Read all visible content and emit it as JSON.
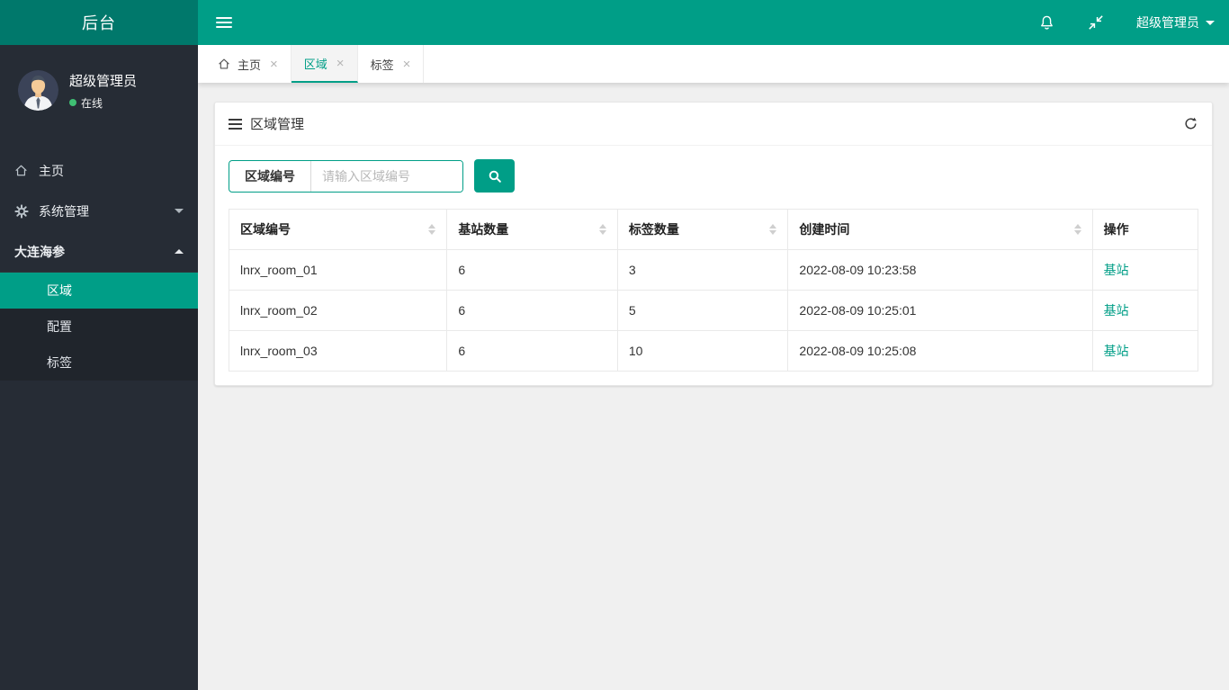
{
  "colors": {
    "accent_teal": "#009e87",
    "logo_teal_dark": "#00786b",
    "sidebar_bg": "#262c35",
    "submenu_bg": "#20252c",
    "online_green": "#3fbf73",
    "link_teal": "#009e87"
  },
  "header": {
    "logo_text": "后台",
    "user_menu_label": "超级管理员"
  },
  "sidebar": {
    "user": {
      "name": "超级管理员",
      "status": "在线"
    },
    "items": [
      {
        "label": "主页"
      },
      {
        "label": "系统管理"
      },
      {
        "label": "大连海参"
      }
    ],
    "subitems": [
      {
        "label": "区域"
      },
      {
        "label": "配置"
      },
      {
        "label": "标签"
      }
    ]
  },
  "tabs": {
    "close_glyph": "×",
    "items": [
      {
        "label": "主页"
      },
      {
        "label": "区域"
      },
      {
        "label": "标签"
      }
    ]
  },
  "panel": {
    "title": "区域管理",
    "search": {
      "field_label": "区域编号",
      "placeholder": "请输入区域编号"
    },
    "table": {
      "columns": [
        {
          "label": "区域编号"
        },
        {
          "label": "基站数量"
        },
        {
          "label": "标签数量"
        },
        {
          "label": "创建时间"
        },
        {
          "label": "操作"
        }
      ],
      "rows": [
        {
          "region_id": "lnrx_room_01",
          "station_count": "6",
          "tag_count": "3",
          "created_at": "2022-08-09 10:23:58",
          "action": "基站"
        },
        {
          "region_id": "lnrx_room_02",
          "station_count": "6",
          "tag_count": "5",
          "created_at": "2022-08-09 10:25:01",
          "action": "基站"
        },
        {
          "region_id": "lnrx_room_03",
          "station_count": "6",
          "tag_count": "10",
          "created_at": "2022-08-09 10:25:08",
          "action": "基站"
        }
      ]
    }
  }
}
